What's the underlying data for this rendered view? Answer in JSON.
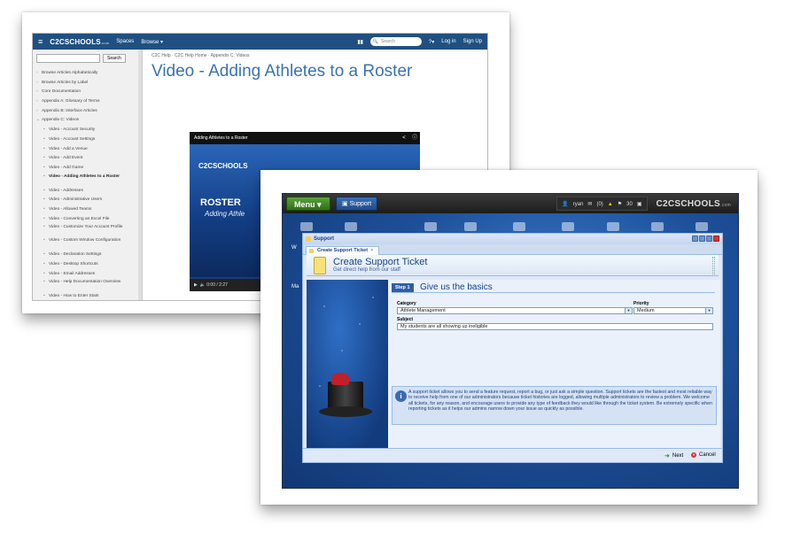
{
  "back": {
    "topbar": {
      "logo": "C2CSCHOOLS",
      "logo_suffix": ".com",
      "spaces": "Spaces",
      "browse": "Browse ▾",
      "search_placeholder": "Search",
      "help": "?▾",
      "login": "Log in",
      "signup": "Sign Up"
    },
    "sidebar": {
      "search_button": "Search",
      "items": [
        {
          "label": "Browse Articles Alphabetically",
          "level": 1
        },
        {
          "label": "Browse Articles by Label",
          "level": 1
        },
        {
          "label": "Core Documentation",
          "level": 1
        },
        {
          "label": "Appendix A: Glossary of Terms",
          "level": 1
        },
        {
          "label": "Appendix B: Interface Articles",
          "level": 1
        },
        {
          "label": "Appendix C: Videos",
          "level": 1
        },
        {
          "label": "Video - Account Security",
          "level": 2
        },
        {
          "label": "Video - Account Settings",
          "level": 2
        },
        {
          "label": "Video - Add a Venue",
          "level": 2
        },
        {
          "label": "Video - Add Event",
          "level": 2
        },
        {
          "label": "Video - Add Game",
          "level": 2
        },
        {
          "label": "Video - Adding Athletes to a Roster",
          "level": 2
        },
        {
          "label": "Video - Addresses",
          "level": 2
        },
        {
          "label": "Video - Administrative Users",
          "level": 2
        },
        {
          "label": "Video - Allowed Teams",
          "level": 2
        },
        {
          "label": "Video - Converting an Excel File",
          "level": 2
        },
        {
          "label": "Video - Customize Your Account Profile",
          "level": 2
        },
        {
          "label": "Video - Custom Window Configuration",
          "level": 2
        },
        {
          "label": "Video - Declaration Settings",
          "level": 2
        },
        {
          "label": "Video - Desktop Shortcuts",
          "level": 2
        },
        {
          "label": "Video - Email Addresses",
          "level": 2
        },
        {
          "label": "Video - Help Documentation Overview",
          "level": 2
        },
        {
          "label": "Video - How to Enter Stats",
          "level": 2
        }
      ]
    },
    "breadcrumb": "C2C Help  ·  C2C Help Home  ·  Appendix C: Videos",
    "page_title": "Video - Adding Athletes to a Roster",
    "video": {
      "title": "Adding Athletes to a Roster",
      "logo": "C2CSCHOOLS",
      "roster": "ROSTER",
      "adding": "Adding Athle",
      "time": "0:00 / 2:27"
    }
  },
  "front": {
    "topbar": {
      "menu": "Menu ▾",
      "support": "Support",
      "user": "ryan",
      "messages": "(0)",
      "count": "30",
      "brand": "C2CSCHOOLS",
      "brand_suffix": ".com"
    },
    "side_labels": [
      "W",
      "Ma"
    ],
    "window": {
      "title": "Support",
      "tab": "Create Support Ticket",
      "header_title": "Create Support Ticket",
      "header_sub": "Get direct help from our staff",
      "step_badge": "Step 1",
      "step_text": "Give us the basics",
      "category_label": "Category",
      "category_value": "Athlete Management",
      "priority_label": "Priority",
      "priority_value": "Medium",
      "subject_label": "Subject",
      "subject_value": "My students are all showing up ineligible",
      "info": "A support ticket allows you to send a feature request, report a bug, or just ask a simple question. Support tickets are the fastest and most reliable way to receive help from one of our administrators because ticket histories are logged, allowing multiple administrators to review a problem. We welcome all tickets, for any reason, and encourage users to provide any type of feedback they would like through the ticket system. Be extremely specific when reporting tickets as it helps our admins narrow down your issue as quickly as possible.",
      "next": "Next",
      "cancel": "Cancel"
    }
  }
}
